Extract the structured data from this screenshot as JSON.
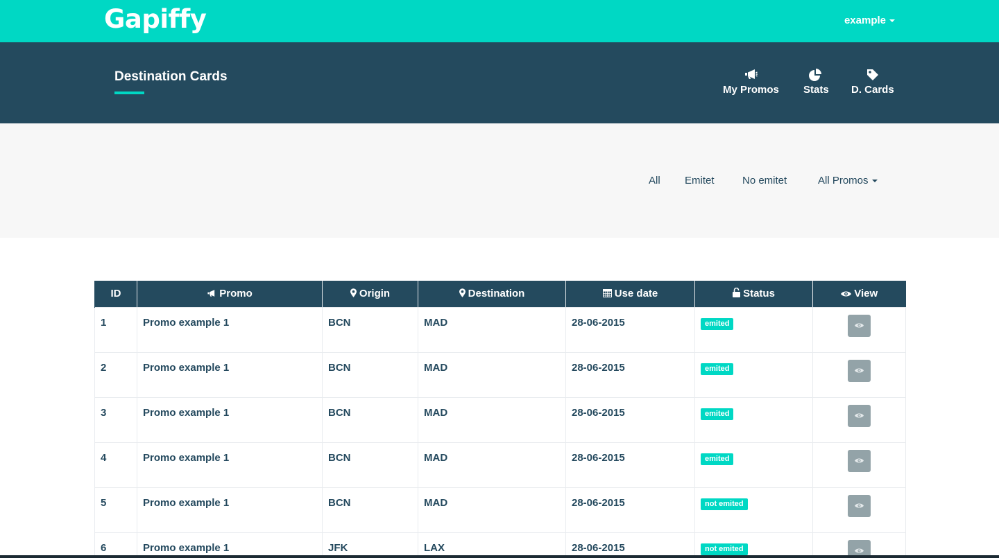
{
  "topbar": {
    "logo": "Gapiffy",
    "user": "example"
  },
  "header": {
    "title": "Destination Cards",
    "nav": [
      {
        "label": "My Promos",
        "icon": "megaphone-icon"
      },
      {
        "label": "Stats",
        "icon": "pie-chart-icon"
      },
      {
        "label": "D. Cards",
        "icon": "tag-icon"
      }
    ]
  },
  "filters": {
    "all": "All",
    "emitet": "Emitet",
    "no_emitet": "No emitet",
    "all_promos": "All Promos"
  },
  "table": {
    "headers": {
      "id": "ID",
      "promo": "Promo",
      "origin": "Origin",
      "destination": "Destination",
      "use_date": "Use date",
      "status": "Status",
      "view": "View"
    },
    "rows": [
      {
        "id": "1",
        "promo": "Promo example 1",
        "origin": "BCN",
        "destination": "MAD",
        "use_date": "28-06-2015",
        "status": "emited"
      },
      {
        "id": "2",
        "promo": "Promo example 1",
        "origin": "BCN",
        "destination": "MAD",
        "use_date": "28-06-2015",
        "status": "emited"
      },
      {
        "id": "3",
        "promo": "Promo example 1",
        "origin": "BCN",
        "destination": "MAD",
        "use_date": "28-06-2015",
        "status": "emited"
      },
      {
        "id": "4",
        "promo": "Promo example 1",
        "origin": "BCN",
        "destination": "MAD",
        "use_date": "28-06-2015",
        "status": "emited"
      },
      {
        "id": "5",
        "promo": "Promo example 1",
        "origin": "BCN",
        "destination": "MAD",
        "use_date": "28-06-2015",
        "status": "not emited"
      },
      {
        "id": "6",
        "promo": "Promo example 1",
        "origin": "JFK",
        "destination": "LAX",
        "use_date": "28-06-2015",
        "status": "not emited"
      }
    ]
  },
  "colors": {
    "brand": "#00d8c4",
    "navy": "#244a5e",
    "button_gray": "#93a3a8"
  }
}
